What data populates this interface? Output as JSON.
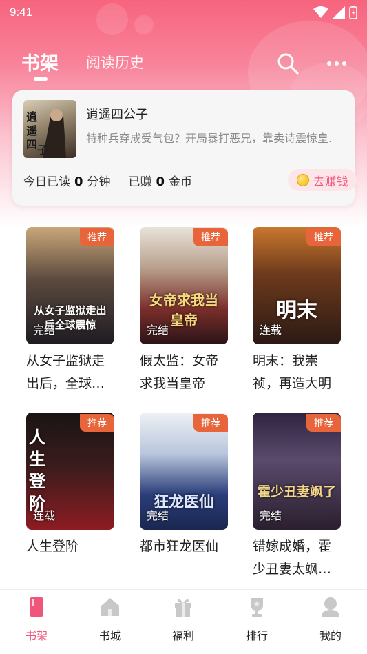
{
  "status_bar": {
    "time": "9:41"
  },
  "header": {
    "tabs": [
      {
        "label": "书架",
        "active": true
      },
      {
        "label": "阅读历史",
        "active": false
      }
    ]
  },
  "recent": {
    "title": "逍遥四公子",
    "description": "特种兵穿成受气包？开局暴打恶兄，靠卖诗震惊皇.",
    "stats": {
      "read_prefix": "今日已读",
      "read_value": "0",
      "read_unit": "分钟",
      "earned_prefix": "已赚",
      "earned_value": "0",
      "earned_unit": "金币"
    },
    "earn_button": "去赚钱"
  },
  "books": [
    {
      "title": "从女子监狱走出后，全球…",
      "cover_title": "从女子监狱走出后全球震惊",
      "badge": "推荐",
      "state": "完结"
    },
    {
      "title": "假太监：女帝求我当皇帝",
      "cover_title": "女帝求我当皇帝",
      "badge": "推荐",
      "state": "完结"
    },
    {
      "title": "明末：我崇祯，再造大明",
      "cover_title": "明末",
      "badge": "推荐",
      "state": "连载"
    },
    {
      "title": "人生登阶",
      "cover_title": "人生登阶",
      "badge": "推荐",
      "state": "连载"
    },
    {
      "title": "都市狂龙医仙",
      "cover_title": "狂龙医仙",
      "badge": "推荐",
      "state": "完结"
    },
    {
      "title": "错嫁成婚，霍少丑妻太飒…",
      "cover_title": "霍少丑妻飒了",
      "badge": "推荐",
      "state": "完结"
    }
  ],
  "bottom_nav": [
    {
      "label": "书架",
      "icon": "bookshelf-icon",
      "active": true
    },
    {
      "label": "书城",
      "icon": "store-icon",
      "active": false
    },
    {
      "label": "福利",
      "icon": "gift-icon",
      "active": false
    },
    {
      "label": "排行",
      "icon": "trophy-icon",
      "active": false
    },
    {
      "label": "我的",
      "icon": "profile-icon",
      "active": false
    }
  ],
  "colors": {
    "accent": "#f0557a",
    "badge": "#e8643a",
    "header_top": "#f7647e"
  }
}
